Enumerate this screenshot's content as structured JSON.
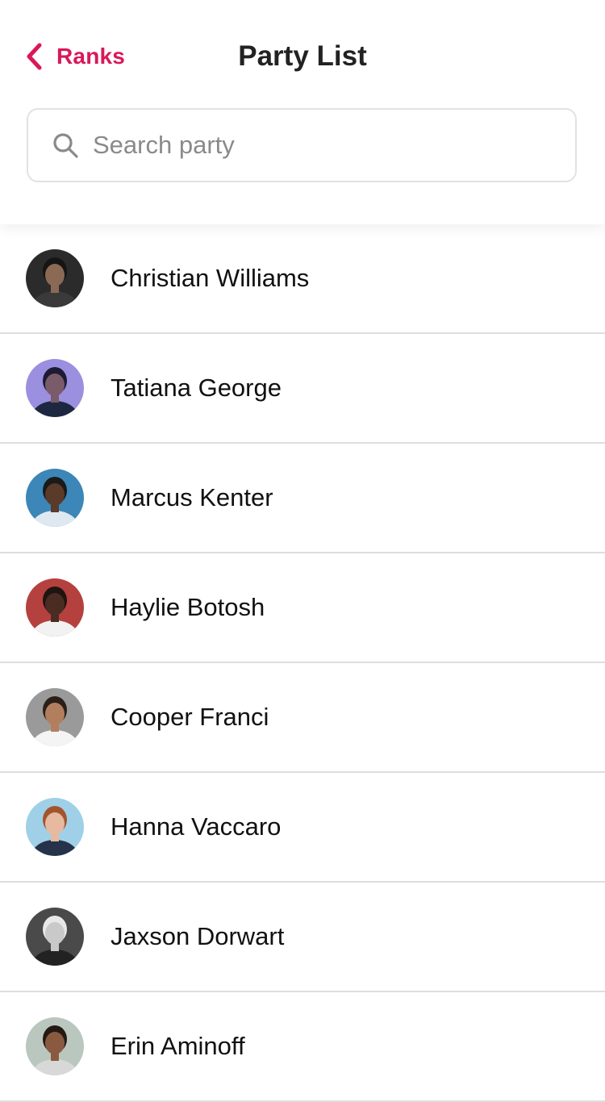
{
  "header": {
    "back_label": "Ranks",
    "title": "Party List",
    "accent_color": "#d9185a"
  },
  "search": {
    "placeholder": "Search party",
    "value": ""
  },
  "parties": [
    {
      "name": "Christian Williams",
      "avatar_colors": {
        "bg": "#2b2b2b",
        "face": "#8a6a55",
        "hair": "#151515",
        "shirt": "#3a3a3a"
      }
    },
    {
      "name": "Tatiana George",
      "avatar_colors": {
        "bg": "#9b8fe0",
        "face": "#7a5b6a",
        "hair": "#1d1b33",
        "shirt": "#1e2740"
      }
    },
    {
      "name": "Marcus Kenter",
      "avatar_colors": {
        "bg": "#3c86b8",
        "face": "#5a3a28",
        "hair": "#1a1a1a",
        "shirt": "#dfe8f0"
      }
    },
    {
      "name": "Haylie Botosh",
      "avatar_colors": {
        "bg": "#b5413e",
        "face": "#4a2c22",
        "hair": "#201410",
        "shirt": "#f2f2f2"
      }
    },
    {
      "name": "Cooper Franci",
      "avatar_colors": {
        "bg": "#9a9a9a",
        "face": "#b27f5e",
        "hair": "#2a2018",
        "shirt": "#f4f4f4"
      }
    },
    {
      "name": "Hanna Vaccaro",
      "avatar_colors": {
        "bg": "#9fd0e8",
        "face": "#e6b9a0",
        "hair": "#a3542f",
        "shirt": "#25324a"
      }
    },
    {
      "name": "Jaxson Dorwart",
      "avatar_colors": {
        "bg": "#4a4a4a",
        "face": "#c9c9c9",
        "hair": "#e8e8e8",
        "shirt": "#222222"
      }
    },
    {
      "name": "Erin Aminoff",
      "avatar_colors": {
        "bg": "#b9c7bf",
        "face": "#8a5a40",
        "hair": "#241a14",
        "shirt": "#d8d8d8"
      }
    }
  ]
}
